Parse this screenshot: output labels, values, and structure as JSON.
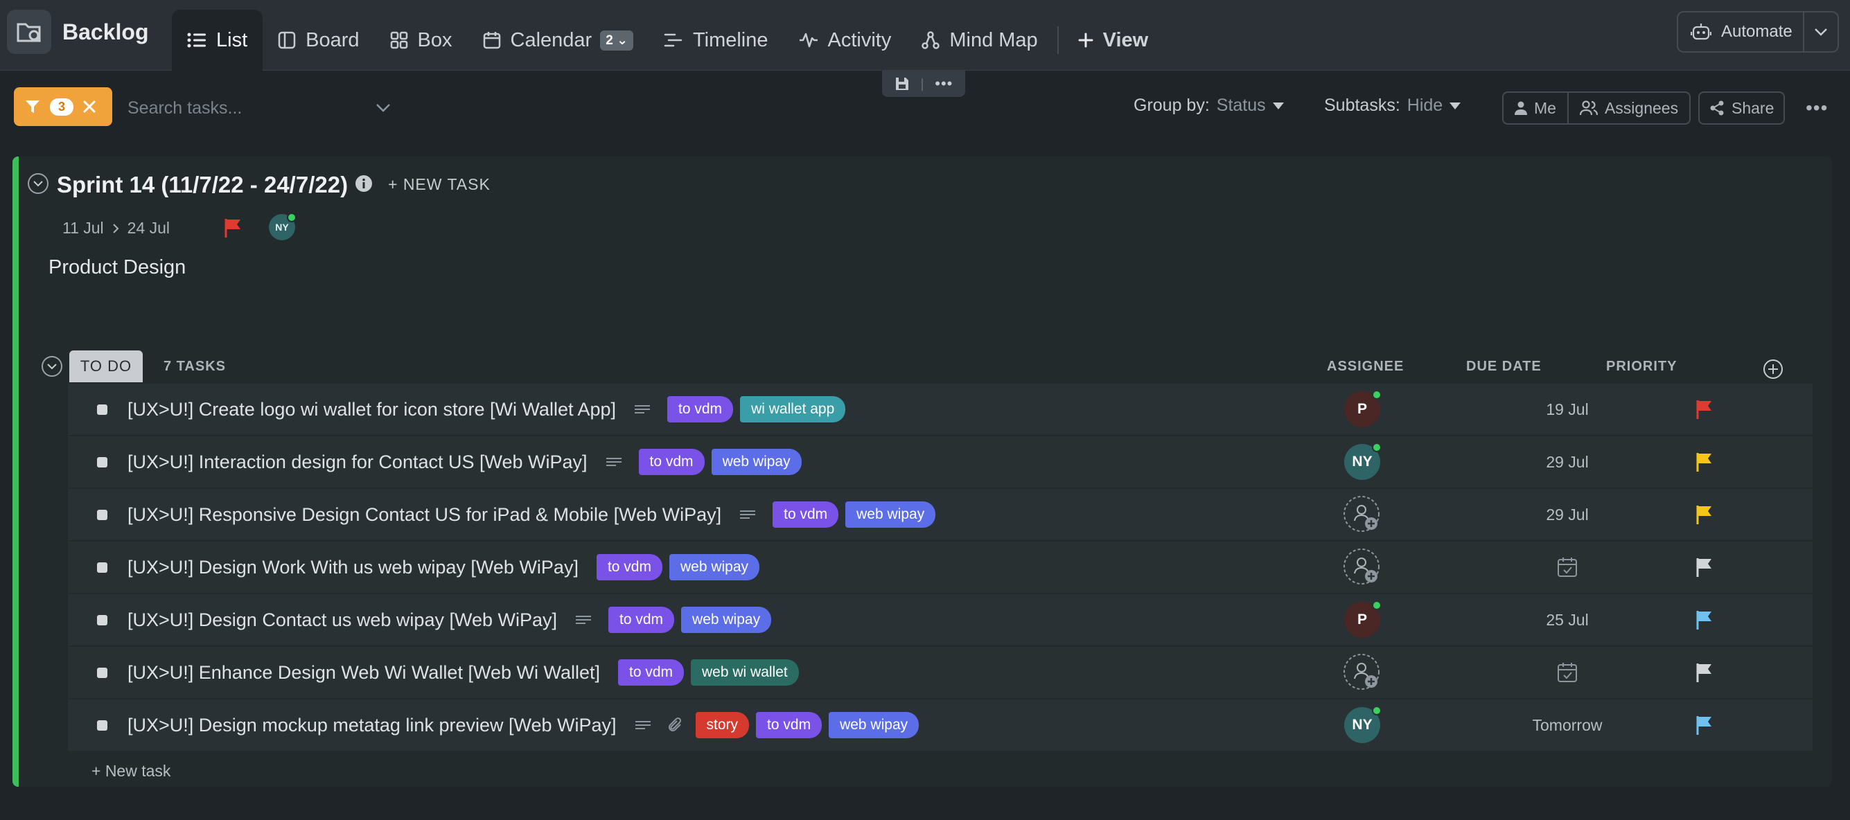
{
  "topbar": {
    "title": "Backlog",
    "tabs": [
      {
        "label": "List",
        "icon": "list-icon",
        "active": true
      },
      {
        "label": "Board",
        "icon": "board-icon"
      },
      {
        "label": "Box",
        "icon": "box-icon"
      },
      {
        "label": "Calendar",
        "icon": "calendar-icon",
        "badge": "2"
      },
      {
        "label": "Timeline",
        "icon": "timeline-icon"
      },
      {
        "label": "Activity",
        "icon": "activity-icon"
      },
      {
        "label": "Mind Map",
        "icon": "mind-map-icon"
      }
    ],
    "add_view_label": "View",
    "automate_label": "Automate"
  },
  "toolbar": {
    "filter_count": "3",
    "search_placeholder": "Search tasks...",
    "group_by_label": "Group by:",
    "group_by_value": "Status",
    "subtasks_label": "Subtasks:",
    "subtasks_value": "Hide",
    "me_label": "Me",
    "assignees_label": "Assignees",
    "share_label": "Share"
  },
  "sprint": {
    "title": "Sprint 14 (11/7/22 - 24/7/22)",
    "new_task_label": "+ NEW TASK",
    "start_date": "11 Jul",
    "end_date": "24 Jul",
    "avatar_initials": "NY",
    "description": "Product Design"
  },
  "group": {
    "status": "TO DO",
    "task_count": "7 TASKS",
    "columns": {
      "assignee": "ASSIGNEE",
      "due_date": "DUE DATE",
      "priority": "PRIORITY"
    },
    "new_task_label": "+ New task"
  },
  "tasks": [
    {
      "name": "[UX>U!] Create logo wi wallet for icon store [Wi Wallet App]",
      "has_desc": true,
      "has_attachment": false,
      "tags": [
        {
          "label": "to vdm",
          "color": "#7b52e8"
        },
        {
          "label": "wi wallet app",
          "color": "#3a9ea8"
        }
      ],
      "assignee": "P",
      "assignee_color": "#4a2624",
      "due": "19 Jul",
      "priority_color": "#e03b30"
    },
    {
      "name": "[UX>U!] Interaction design for Contact US [Web WiPay]",
      "has_desc": true,
      "has_attachment": false,
      "tags": [
        {
          "label": "to vdm",
          "color": "#7b52e8"
        },
        {
          "label": "web wipay",
          "color": "#5b6ee8"
        }
      ],
      "assignee": "NY",
      "assignee_color": "#2f6466",
      "due": "29 Jul",
      "priority_color": "#f5c518"
    },
    {
      "name": "[UX>U!] Responsive Design Contact US for iPad & Mobile [Web WiPay]",
      "has_desc": true,
      "has_attachment": false,
      "tags": [
        {
          "label": "to vdm",
          "color": "#7b52e8"
        },
        {
          "label": "web wipay",
          "color": "#5b6ee8"
        }
      ],
      "assignee": "",
      "due": "29 Jul",
      "priority_color": "#f5c518"
    },
    {
      "name": "[UX>U!] Design Work With us web wipay [Web WiPay]",
      "has_desc": false,
      "has_attachment": false,
      "tags": [
        {
          "label": "to vdm",
          "color": "#7b52e8"
        },
        {
          "label": "web wipay",
          "color": "#5b6ee8"
        }
      ],
      "assignee": "",
      "due": "",
      "priority_color": "#d2d5d8"
    },
    {
      "name": "[UX>U!] Design Contact us web wipay [Web WiPay]",
      "has_desc": true,
      "has_attachment": false,
      "tags": [
        {
          "label": "to vdm",
          "color": "#7b52e8"
        },
        {
          "label": "web wipay",
          "color": "#5b6ee8"
        }
      ],
      "assignee": "P",
      "assignee_color": "#4a2624",
      "due": "25 Jul",
      "priority_color": "#6fc2f0"
    },
    {
      "name": "[UX>U!] Enhance Design Web Wi Wallet [Web Wi Wallet]",
      "has_desc": false,
      "has_attachment": false,
      "tags": [
        {
          "label": "to vdm",
          "color": "#7b52e8"
        },
        {
          "label": "web wi wallet",
          "color": "#2a6b62"
        }
      ],
      "assignee": "",
      "due": "",
      "priority_color": "#d2d5d8"
    },
    {
      "name": "[UX>U!] Design mockup metatag link preview [Web WiPay]",
      "has_desc": true,
      "has_attachment": true,
      "tags": [
        {
          "label": "story",
          "color": "#d63a2e"
        },
        {
          "label": "to vdm",
          "color": "#7b52e8"
        },
        {
          "label": "web wipay",
          "color": "#5b6ee8"
        }
      ],
      "assignee": "NY",
      "assignee_color": "#2f6466",
      "due": "Tomorrow",
      "priority_color": "#6fc2f0"
    }
  ]
}
